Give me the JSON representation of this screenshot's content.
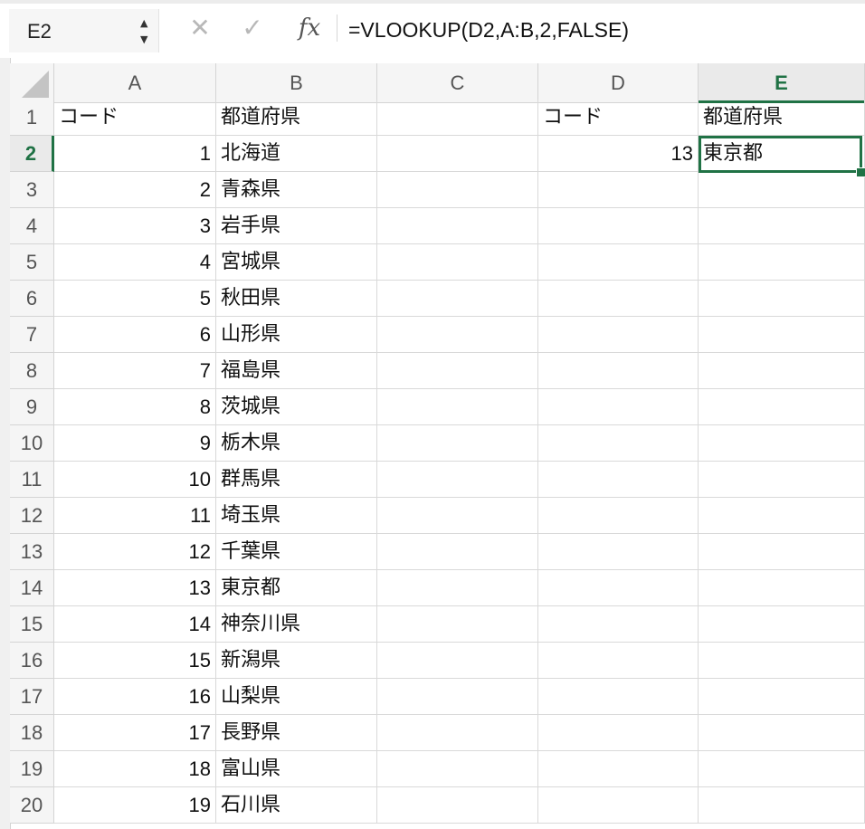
{
  "formula_bar": {
    "name_box": "E2",
    "formula": "=VLOOKUP(D2,A:B,2,FALSE)",
    "cancel_icon": "close-icon",
    "enter_icon": "checkmark-icon",
    "fx_label": "fx"
  },
  "sheet": {
    "columns": [
      "A",
      "B",
      "C",
      "D",
      "E"
    ],
    "active_column": "E",
    "active_row": "2",
    "accent_color": "#207245",
    "rows": [
      {
        "num": "1",
        "A": "コード",
        "B": "都道府県",
        "C": "",
        "D": "コード",
        "E": "都道府県"
      },
      {
        "num": "2",
        "A": "1",
        "B": "北海道",
        "C": "",
        "D": "13",
        "E": "東京都"
      },
      {
        "num": "3",
        "A": "2",
        "B": "青森県",
        "C": "",
        "D": "",
        "E": ""
      },
      {
        "num": "4",
        "A": "3",
        "B": "岩手県",
        "C": "",
        "D": "",
        "E": ""
      },
      {
        "num": "5",
        "A": "4",
        "B": "宮城県",
        "C": "",
        "D": "",
        "E": ""
      },
      {
        "num": "6",
        "A": "5",
        "B": "秋田県",
        "C": "",
        "D": "",
        "E": ""
      },
      {
        "num": "7",
        "A": "6",
        "B": "山形県",
        "C": "",
        "D": "",
        "E": ""
      },
      {
        "num": "8",
        "A": "7",
        "B": "福島県",
        "C": "",
        "D": "",
        "E": ""
      },
      {
        "num": "9",
        "A": "8",
        "B": "茨城県",
        "C": "",
        "D": "",
        "E": ""
      },
      {
        "num": "10",
        "A": "9",
        "B": "栃木県",
        "C": "",
        "D": "",
        "E": ""
      },
      {
        "num": "11",
        "A": "10",
        "B": "群馬県",
        "C": "",
        "D": "",
        "E": ""
      },
      {
        "num": "12",
        "A": "11",
        "B": "埼玉県",
        "C": "",
        "D": "",
        "E": ""
      },
      {
        "num": "13",
        "A": "12",
        "B": "千葉県",
        "C": "",
        "D": "",
        "E": ""
      },
      {
        "num": "14",
        "A": "13",
        "B": "東京都",
        "C": "",
        "D": "",
        "E": ""
      },
      {
        "num": "15",
        "A": "14",
        "B": "神奈川県",
        "C": "",
        "D": "",
        "E": ""
      },
      {
        "num": "16",
        "A": "15",
        "B": "新潟県",
        "C": "",
        "D": "",
        "E": ""
      },
      {
        "num": "17",
        "A": "16",
        "B": "山梨県",
        "C": "",
        "D": "",
        "E": ""
      },
      {
        "num": "18",
        "A": "17",
        "B": "長野県",
        "C": "",
        "D": "",
        "E": ""
      },
      {
        "num": "19",
        "A": "18",
        "B": "富山県",
        "C": "",
        "D": "",
        "E": ""
      },
      {
        "num": "20",
        "A": "19",
        "B": "石川県",
        "C": "",
        "D": "",
        "E": ""
      }
    ]
  }
}
